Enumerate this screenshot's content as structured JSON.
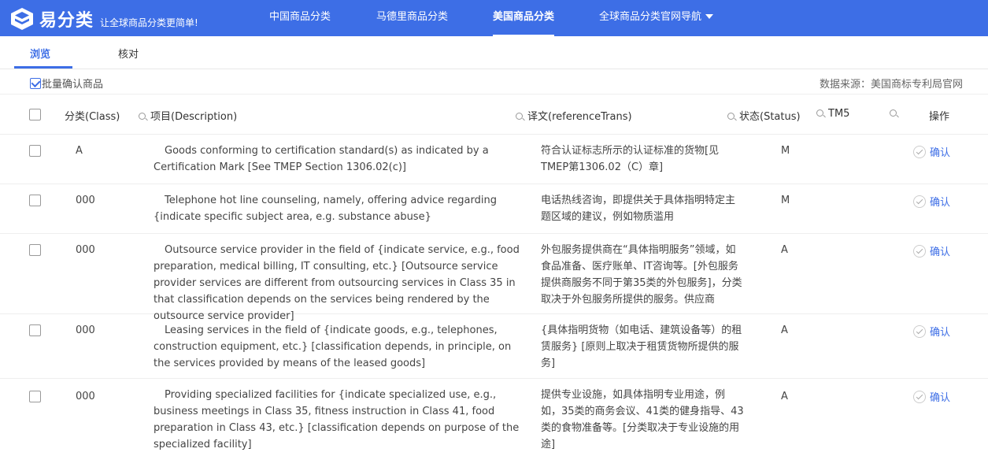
{
  "header": {
    "brand": "易分类",
    "slogan": "让全球商品分类更简单!",
    "nav": [
      {
        "label": "中国商品分类"
      },
      {
        "label": "马德里商品分类"
      },
      {
        "label": "美国商品分类",
        "active": true
      },
      {
        "label": "全球商品分类官网导航"
      }
    ]
  },
  "tabs": [
    {
      "label": "浏览",
      "active": true
    },
    {
      "label": "核对"
    }
  ],
  "toolbar": {
    "batch_label": "批量确认商品",
    "source_label": "数据来源：美国商标专利局官网"
  },
  "table": {
    "columns": {
      "class": "分类(Class)",
      "description": "项目(Description)",
      "trans": "译文(referenceTrans)",
      "status": "状态(Status)",
      "tm5": "TM5",
      "action": "操作"
    },
    "confirm_label": "确认",
    "rows": [
      {
        "class": "A",
        "description": "Goods conforming to certification standard(s) as indicated by a Certification Mark [See TMEP Section 1306.02(c)]",
        "trans": "符合认证标志所示的认证标准的货物[见TMEP第1306.02（C）章]",
        "status": "M"
      },
      {
        "class": "000",
        "description": "Telephone hot line counseling, namely, offering advice regarding {indicate specific subject area, e.g. substance abuse}",
        "trans": "电话热线咨询，即提供关于具体指明特定主题区域的建议，例如物质滥用",
        "status": "M"
      },
      {
        "class": "000",
        "description": "Outsource service provider in the field of {indicate service, e.g., food preparation, medical billing, IT consulting, etc.} [Outsource service provider services are different from outsourcing services in Class 35 in that classification depends on the services being rendered by the outsource service provider]",
        "trans": "外包服务提供商在“具体指明服务”领域，如食品准备、医疗账单、IT咨询等。[外包服务提供商服务不同于第35类的外包服务]，分类取决于外包服务所提供的服务。供应商",
        "status": "A"
      },
      {
        "class": "000",
        "description": "Leasing services in the field of {indicate goods, e.g., telephones, construction equipment, etc.} [classification depends, in principle, on the services provided by means of the leased goods]",
        "trans": "{具体指明货物（如电话、建筑设备等）的租赁服务} [原则上取决于租赁货物所提供的服务]",
        "status": "A"
      },
      {
        "class": "000",
        "description": "Providing specialized facilities for {indicate specialized use, e.g., business meetings in Class 35, fitness instruction in Class 41, food preparation in Class 43, etc.} [classification depends on purpose of the specialized facility]",
        "trans": "提供专业设施，如具体指明专业用途，例如，35类的商务会议、41类的健身指导、43类的食物准备等。[分类取决于专业设施的用途]",
        "status": "A"
      }
    ]
  },
  "colors": {
    "primary": "#3d6ee6",
    "header_bg": "#3d6ee6"
  }
}
